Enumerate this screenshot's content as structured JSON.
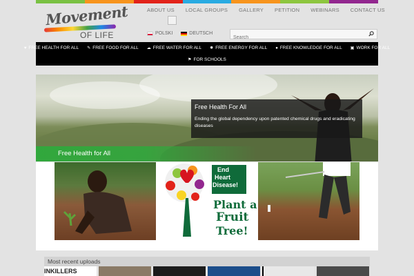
{
  "brand": {
    "logo_word": "Movement",
    "logo_sub": "OF LIFE",
    "strip_colors": [
      "#7ac143",
      "#f7941d",
      "#e2231a",
      "#29abe2",
      "#f7941d",
      "#8dc63f",
      "#92278f"
    ]
  },
  "top_nav": [
    {
      "label": "ABOUT US"
    },
    {
      "label": "LOCAL GROUPS"
    },
    {
      "label": "GALLERY"
    },
    {
      "label": "PETITION"
    },
    {
      "label": "WEBINARS"
    },
    {
      "label": "CONTACT US"
    }
  ],
  "languages": [
    {
      "label": "POLSKI",
      "flag": "poland-flag-icon"
    },
    {
      "label": "DEUTSCH",
      "flag": "germany-flag-icon"
    }
  ],
  "search": {
    "placeholder": "Search",
    "icon": "search-icon"
  },
  "main_nav": {
    "row1": [
      {
        "label": "FREE HEALTH FOR ALL",
        "icon": "heart-icon",
        "glyph": "♥"
      },
      {
        "label": "FREE FOOD FOR ALL",
        "icon": "fork-icon",
        "glyph": "✎"
      },
      {
        "label": "FREE WATER FOR ALL",
        "icon": "cloud-icon",
        "glyph": "☁"
      },
      {
        "label": "FREE ENERGY FOR ALL",
        "icon": "gear-icon",
        "glyph": "✹"
      },
      {
        "label": "FREE KNOWLEDGE FOR ALL",
        "icon": "lightbulb-icon",
        "glyph": "●"
      },
      {
        "label": "WORK FOR ALL",
        "icon": "briefcase-icon",
        "glyph": "▣"
      }
    ],
    "row2": [
      {
        "label": "FOR SCHOOLS",
        "icon": "flag-icon",
        "glyph": "⚑"
      }
    ]
  },
  "hero": {
    "caption_title": "Free Health For All",
    "caption_text": "Ending the global dependency upon patented chemical drugs and eradicating diseases",
    "label": "Free Health for All"
  },
  "thumbs": {
    "poster_line1": "End",
    "poster_line2": "Heart",
    "poster_line3": "Disease!",
    "poster_line4": "Plant a",
    "poster_line5": "Fruit",
    "poster_line6": "Tree!"
  },
  "recent": {
    "title": "Most recent uploads",
    "first_thumb_text": "INKILLERS"
  }
}
